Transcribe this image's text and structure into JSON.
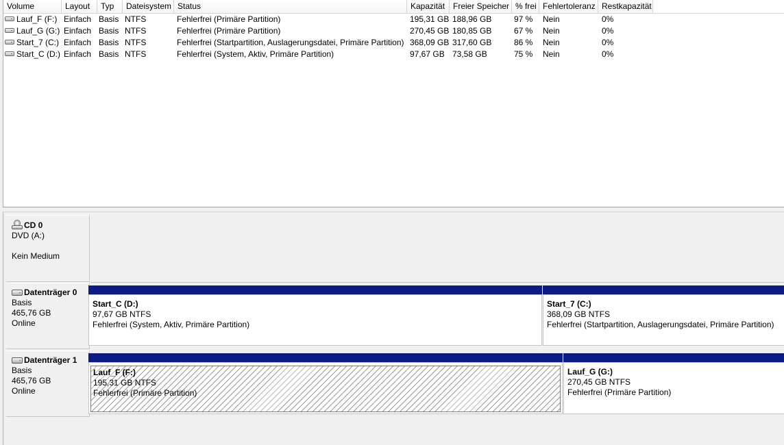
{
  "columns": [
    "Volume",
    "Layout",
    "Typ",
    "Dateisystem",
    "Status",
    "Kapazität",
    "Freier Speicher",
    "% frei",
    "Fehlertoleranz",
    "Restkapazität"
  ],
  "volumes": [
    {
      "volume": "Lauf_F (F:)",
      "layout": "Einfach",
      "typ": "Basis",
      "fs": "NTFS",
      "status": "Fehlerfrei (Primäre Partition)",
      "kapazitaet": "195,31 GB",
      "frei": "188,96 GB",
      "pfrei": "97 %",
      "fehlertoleranz": "Nein",
      "rest": "0%"
    },
    {
      "volume": "Lauf_G (G:)",
      "layout": "Einfach",
      "typ": "Basis",
      "fs": "NTFS",
      "status": "Fehlerfrei (Primäre Partition)",
      "kapazitaet": "270,45 GB",
      "frei": "180,85 GB",
      "pfrei": "67 %",
      "fehlertoleranz": "Nein",
      "rest": "0%"
    },
    {
      "volume": "Start_7 (C:)",
      "layout": "Einfach",
      "typ": "Basis",
      "fs": "NTFS",
      "status": "Fehlerfrei (Startpartition, Auslagerungsdatei, Primäre Partition)",
      "kapazitaet": "368,09 GB",
      "frei": "317,60 GB",
      "pfrei": "86 %",
      "fehlertoleranz": "Nein",
      "rest": "0%"
    },
    {
      "volume": "Start_C (D:)",
      "layout": "Einfach",
      "typ": "Basis",
      "fs": "NTFS",
      "status": "Fehlerfrei (System, Aktiv, Primäre Partition)",
      "kapazitaet": "97,67 GB",
      "frei": "73,58 GB",
      "pfrei": "75 %",
      "fehlertoleranz": "Nein",
      "rest": "0%"
    }
  ],
  "cd": {
    "title": "CD 0",
    "line1": "DVD (A:)",
    "line2": "Kein Medium"
  },
  "disk0": {
    "title": "Datenträger 0",
    "type": "Basis",
    "size": "465,76 GB",
    "state": "Online",
    "partitions": [
      {
        "name": "Start_C  (D:)",
        "size": "97,67 GB NTFS",
        "status": "Fehlerfrei (System, Aktiv, Primäre Partition)"
      },
      {
        "name": "Start_7  (C:)",
        "size": "368,09 GB NTFS",
        "status": "Fehlerfrei (Startpartition, Auslagerungsdatei, Primäre Partition)"
      }
    ]
  },
  "disk1": {
    "title": "Datenträger 1",
    "type": "Basis",
    "size": "465,76 GB",
    "state": "Online",
    "partitions": [
      {
        "name": "Lauf_F  (F:)",
        "size": "195,31 GB NTFS",
        "status": "Fehlerfrei (Primäre Partition)"
      },
      {
        "name": "Lauf_G  (G:)",
        "size": "270,45 GB NTFS",
        "status": "Fehlerfrei (Primäre Partition)"
      }
    ]
  },
  "colors": {
    "partition_bar": "#0b1c84",
    "background": "#f0f0f0"
  },
  "icons": {
    "volume": "drive-icon",
    "disk": "hard-disk-icon",
    "cd": "cd-drive-icon"
  }
}
